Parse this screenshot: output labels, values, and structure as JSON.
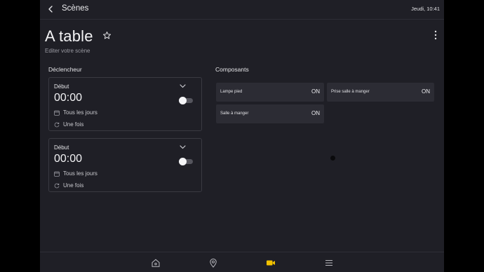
{
  "header": {
    "title": "Scènes",
    "clock": "Jeudi, 10:41"
  },
  "page": {
    "title": "A table",
    "subtitle": "Editer votre scène"
  },
  "triggers": {
    "section_label": "Déclencheur",
    "items": [
      {
        "label": "Début",
        "time": "00:00",
        "days": "Tous les jours",
        "repeat": "Une fois",
        "enabled": false
      },
      {
        "label": "Début",
        "time": "00:00",
        "days": "Tous les jours",
        "repeat": "Une fois",
        "enabled": false
      }
    ]
  },
  "components": {
    "section_label": "Composants",
    "items": [
      {
        "name": "Lampe pied",
        "state": "ON"
      },
      {
        "name": "Prise salle à manger",
        "state": "ON"
      },
      {
        "name": "Salle à manger",
        "state": "ON"
      }
    ]
  },
  "nav": {
    "items": [
      "home-icon",
      "location-pin-icon",
      "camera-icon",
      "menu-icon"
    ],
    "active_color": "#f2c200",
    "icon_color": "#b8b8be"
  }
}
